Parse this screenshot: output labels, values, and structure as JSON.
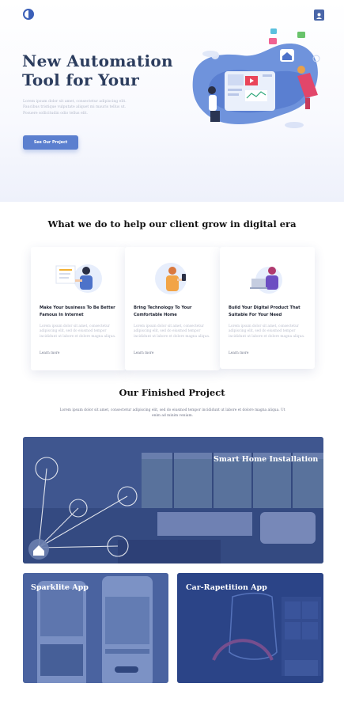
{
  "hero": {
    "title_line1": "New Automation",
    "title_line2": "Tool for Your",
    "description": "Lorem ipsum dolor sit amet, consectetur adipiscing elit. Faucibus tristique vulputate aliquet mi mauris tellus ut. Posuere sollicitudin odio tellus elit.",
    "cta_label": "See Our Project"
  },
  "services": {
    "title": "What we do to help our client grow in digital era",
    "cards": [
      {
        "title": "Make Your business To Be Better Famous In Internet",
        "text": "Lorem ipsum dolor sit amet, consectetur adipiscing elit, sed do eiusmod tempor incididunt ut labore et dolore magna aliqua.",
        "link": "Learn more"
      },
      {
        "title": "Bring Technology To Your Comfortable Home",
        "text": "Lorem ipsum dolor sit amet, consectetur adipiscing elit, sed do eiusmod tempor incididunt ut labore et dolore magna aliqua.",
        "link": "Learn more"
      },
      {
        "title": "Build Your Digital Product That Suitable For Your Need",
        "text": "Lorem ipsum dolor sit amet, consectetur adipiscing elit, sed do eiusmod tempor incididunt ut labore et dolore magna aliqua.",
        "link": "Learn more"
      }
    ]
  },
  "projects": {
    "title": "Our Finished Project",
    "description": "Lorem ipsum dolor sit amet, consectetur adipiscing elit, sed do eiusmod tempor incididunt ut labore et dolore magna aliqua. Ut enim ad minim veniam.",
    "items": [
      {
        "label": "Smart Home Installation"
      },
      {
        "label": "Sparklite App"
      },
      {
        "label": "Car-Rapetition App"
      }
    ]
  },
  "colors": {
    "primary": "#5b7fcf",
    "navy": "#2c3d5e",
    "overlay": "#3a5bb0"
  },
  "icons": {
    "logo": "half-circle-logo-icon",
    "menu": "contact-book-icon",
    "home": "home-icon"
  }
}
